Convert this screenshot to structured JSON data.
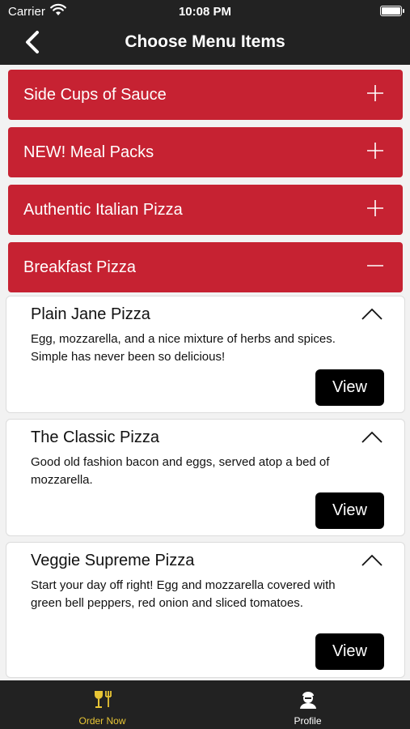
{
  "status_bar": {
    "carrier": "Carrier",
    "time": "10:08 PM"
  },
  "header": {
    "title": "Choose Menu Items"
  },
  "categories": [
    {
      "label": "Side Cups of Sauce",
      "state": "collapsed"
    },
    {
      "label": "NEW! Meal Packs",
      "state": "collapsed"
    },
    {
      "label": "Authentic Italian Pizza",
      "state": "collapsed"
    },
    {
      "label": "Breakfast Pizza",
      "state": "expanded"
    }
  ],
  "items": [
    {
      "name": "Plain Jane Pizza",
      "description": "Egg, mozzarella, and a nice mixture of herbs and spices. Simple has never been so delicious!",
      "button": "View"
    },
    {
      "name": "The Classic Pizza",
      "description": "Good old fashion bacon and eggs, served atop a bed of mozzarella.",
      "button": "View"
    },
    {
      "name": "Veggie Supreme Pizza",
      "description": "Start your day off right! Egg and mozzarella covered with green bell peppers, red onion and sliced tomatoes.",
      "button": "View"
    }
  ],
  "tab_bar": {
    "tabs": [
      {
        "label": "Order Now",
        "icon": "food-drink-icon",
        "active": true
      },
      {
        "label": "Profile",
        "icon": "chef-icon",
        "active": false
      }
    ]
  },
  "colors": {
    "header": "#222222",
    "category": "#c62232",
    "active_tab": "#e8c535",
    "inactive_tab": "#ffffff"
  }
}
